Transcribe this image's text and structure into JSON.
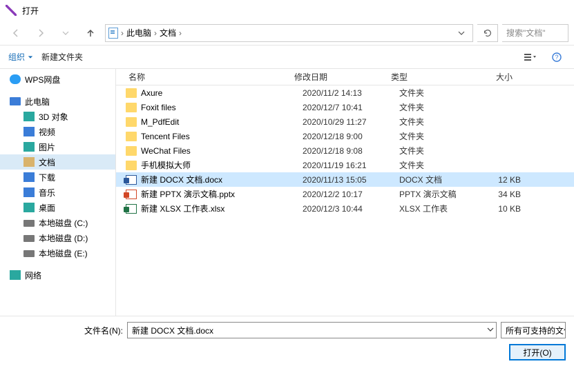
{
  "title": "打开",
  "breadcrumb": {
    "seg1": "此电脑",
    "seg2": "文档"
  },
  "search_placeholder": "搜索\"文档\"",
  "toolbar": {
    "organize": "组织",
    "new_folder": "新建文件夹"
  },
  "sidebar": {
    "wps": "WPS网盘",
    "pc": "此电脑",
    "d3": "3D 对象",
    "video": "视频",
    "pic": "图片",
    "doc": "文档",
    "down": "下载",
    "music": "音乐",
    "desk": "桌面",
    "disk_c": "本地磁盘 (C:)",
    "disk_d": "本地磁盘 (D:)",
    "disk_e": "本地磁盘 (E:)",
    "net": "网络"
  },
  "columns": {
    "name": "名称",
    "date": "修改日期",
    "type": "类型",
    "size": "大小"
  },
  "rows": [
    {
      "icon": "folder",
      "name": "Axure",
      "date": "2020/11/2 14:13",
      "type": "文件夹",
      "size": ""
    },
    {
      "icon": "folder",
      "name": "Foxit files",
      "date": "2020/12/7 10:41",
      "type": "文件夹",
      "size": ""
    },
    {
      "icon": "folder",
      "name": "M_PdfEdit",
      "date": "2020/10/29 11:27",
      "type": "文件夹",
      "size": ""
    },
    {
      "icon": "folder",
      "name": "Tencent Files",
      "date": "2020/12/18 9:00",
      "type": "文件夹",
      "size": ""
    },
    {
      "icon": "folder",
      "name": "WeChat Files",
      "date": "2020/12/18 9:08",
      "type": "文件夹",
      "size": ""
    },
    {
      "icon": "folder",
      "name": "手机模拟大师",
      "date": "2020/11/19 16:21",
      "type": "文件夹",
      "size": ""
    },
    {
      "icon": "docx",
      "name": "新建 DOCX 文档.docx",
      "date": "2020/11/13 15:05",
      "type": "DOCX 文档",
      "size": "12 KB",
      "selected": true
    },
    {
      "icon": "pptx",
      "name": "新建 PPTX 演示文稿.pptx",
      "date": "2020/12/2 10:17",
      "type": "PPTX 演示文稿",
      "size": "34 KB"
    },
    {
      "icon": "xlsx",
      "name": "新建 XLSX 工作表.xlsx",
      "date": "2020/12/3 10:44",
      "type": "XLSX 工作表",
      "size": "10 KB"
    }
  ],
  "footer": {
    "filename_label": "文件名(N):",
    "filename_value": "新建 DOCX 文档.docx",
    "filter": "所有可支持的文件",
    "open": "打开(O)"
  }
}
